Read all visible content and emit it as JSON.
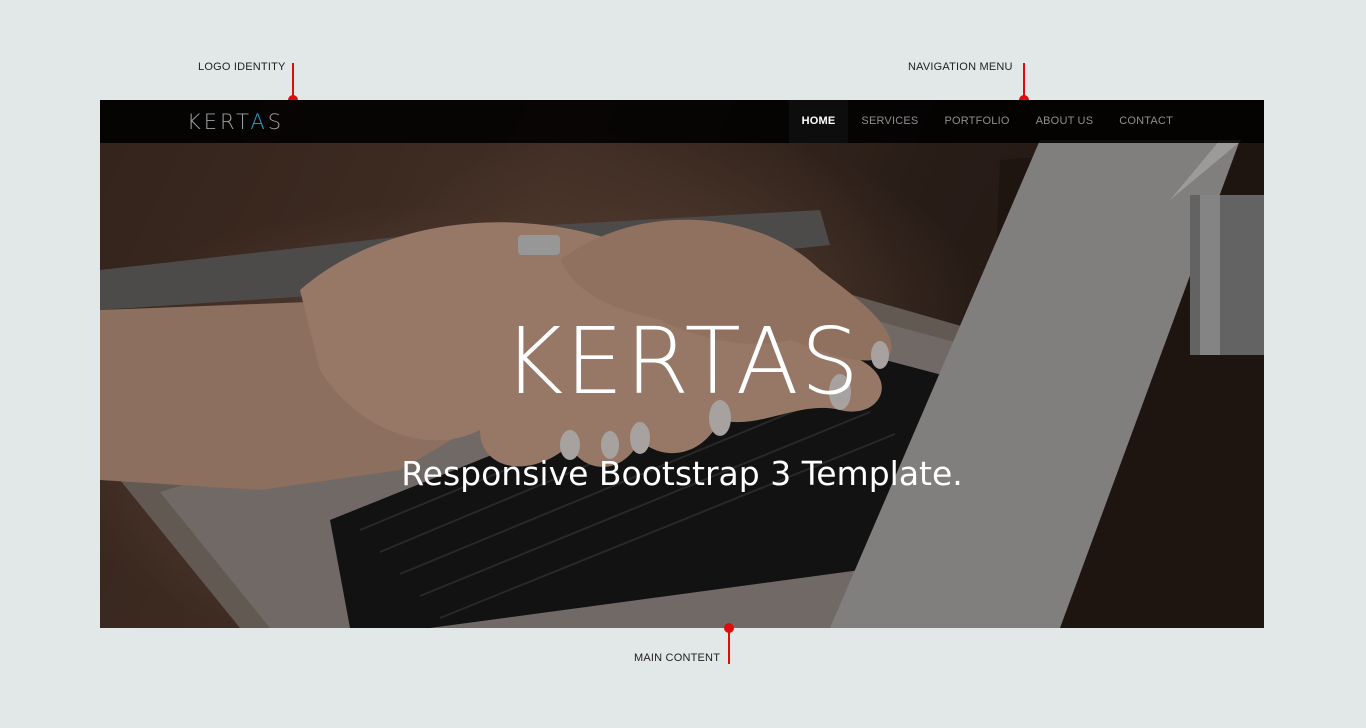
{
  "annotations": {
    "logo_identity": "LOGO IDENTITY",
    "navigation_menu": "NAVIGATION MENU",
    "main_content": "MAIN CONTENT",
    "marker_color": "#e10b0b"
  },
  "site": {
    "logo": {
      "text_main": "KERT",
      "text_accent": "A",
      "text_end": "S",
      "accent_color": "#2aa3d8"
    },
    "nav": {
      "items": [
        {
          "label": "HOME",
          "active": true
        },
        {
          "label": "SERVICES",
          "active": false
        },
        {
          "label": "PORTFOLIO",
          "active": false
        },
        {
          "label": "ABOUT US",
          "active": false
        },
        {
          "label": "CONTACT",
          "active": false
        }
      ]
    },
    "hero": {
      "title": "KERTAS",
      "subtitle": "Responsive Bootstrap 3 Template."
    }
  }
}
